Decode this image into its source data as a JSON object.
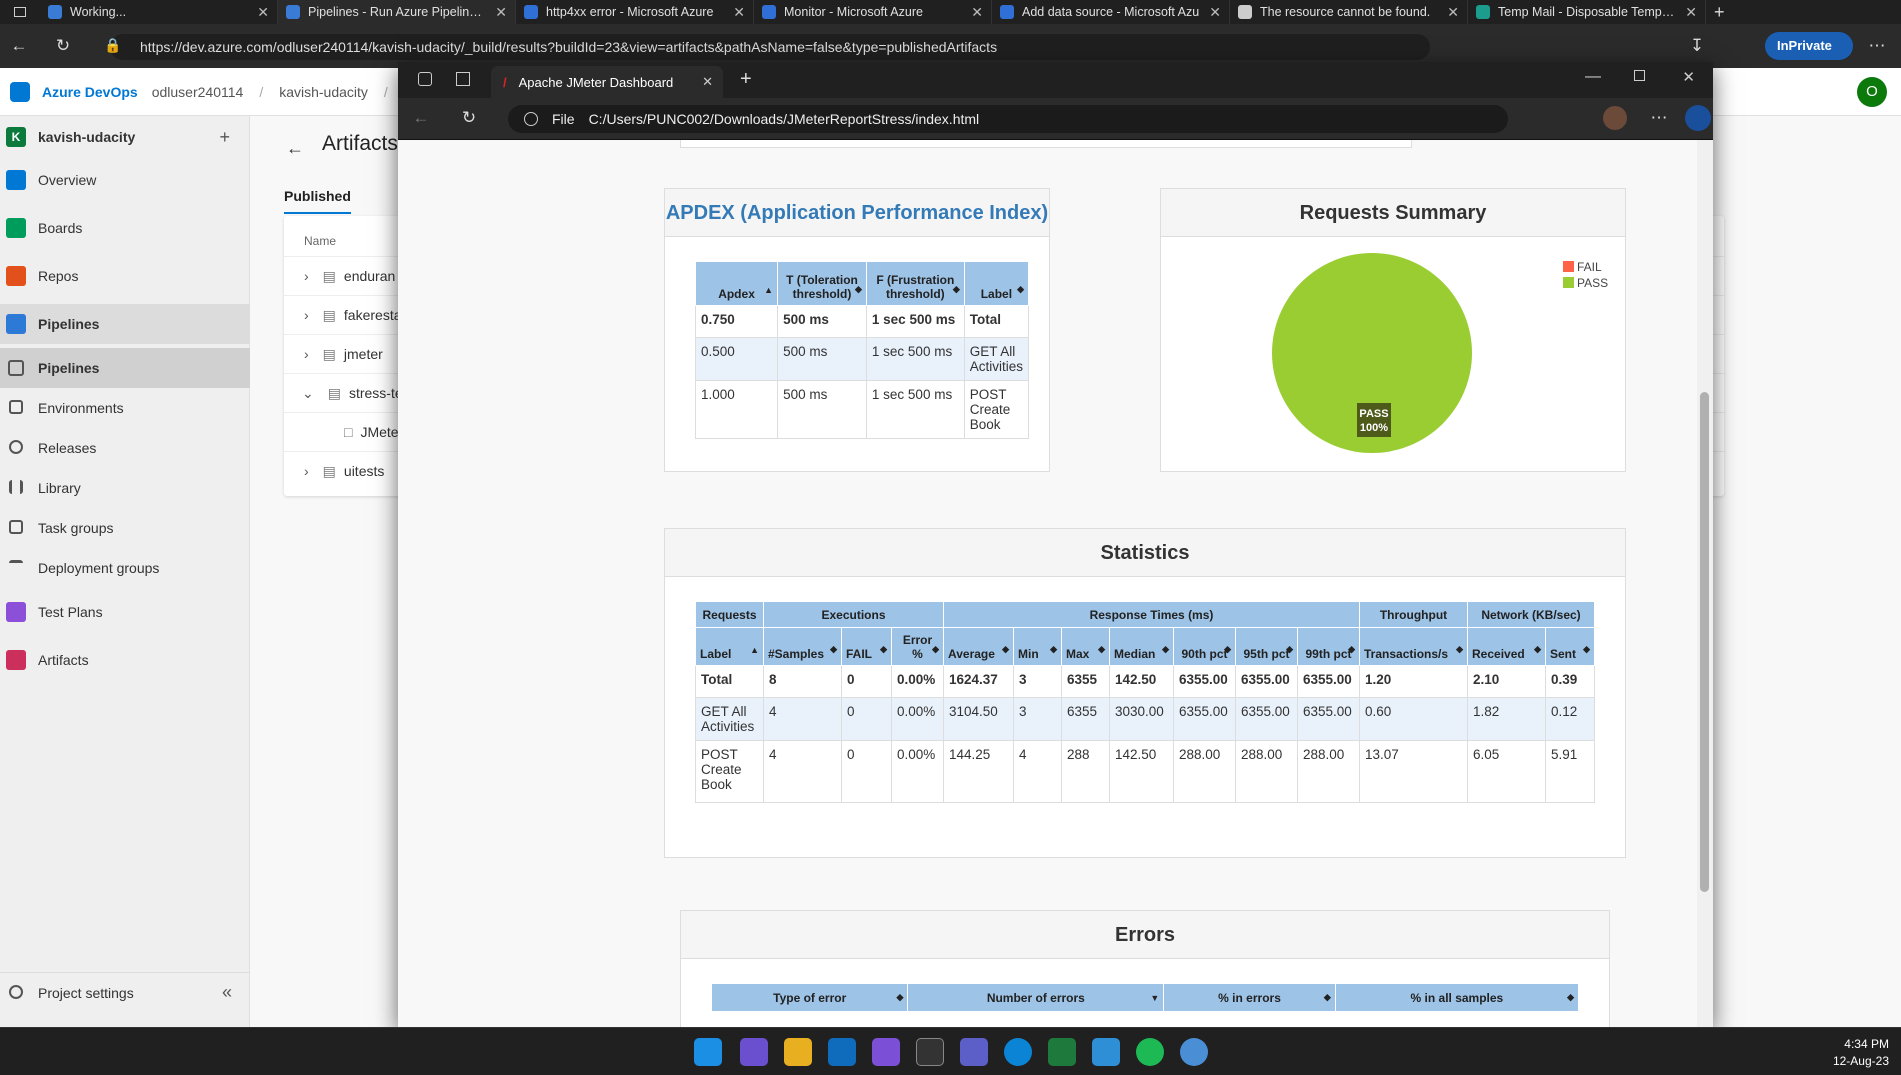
{
  "outer_tabs": [
    {
      "title": "Working..."
    },
    {
      "title": "Pipelines - Run Azure Pipelines a"
    },
    {
      "title": "http4xx error - Microsoft Azure"
    },
    {
      "title": "Monitor - Microsoft Azure"
    },
    {
      "title": "Add data source - Microsoft Azu"
    },
    {
      "title": "The resource cannot be found."
    },
    {
      "title": "Temp Mail - Disposable Tempora"
    }
  ],
  "outer_url": "https://dev.azure.com/odluser240114/kavish-udacity/_build/results?buildId=23&view=artifacts&pathAsName=false&type=publishedArtifacts",
  "inprivate_label": "InPrivate",
  "ado": {
    "brand": "Azure DevOps",
    "org": "odluser240114",
    "project_crumb": "kavish-udacity",
    "project_name": "kavish-udacity",
    "project_initial": "K",
    "nav": [
      "Overview",
      "Boards",
      "Repos",
      "Pipelines",
      "Pipelines",
      "Environments",
      "Releases",
      "Library",
      "Task groups",
      "Deployment groups",
      "Test Plans",
      "Artifacts"
    ],
    "settings": "Project settings",
    "page_title": "Artifacts",
    "tab_published": "Published",
    "col_name": "Name",
    "artifacts": [
      "enduran",
      "fakeresta",
      "jmeter",
      "stress-te",
      "JMete",
      "uitests"
    ]
  },
  "jmeter": {
    "tab_title": "Apache JMeter Dashboard",
    "url_scheme": "File",
    "url": "C:/Users/PUNC002/Downloads/JMeterReportStress/index.html",
    "apdex": {
      "title": "APDEX (Application Performance Index)",
      "headers": [
        "Apdex",
        "T (Toleration threshold)",
        "F (Frustration threshold)",
        "Label"
      ],
      "rows": [
        [
          "0.750",
          "500 ms",
          "1 sec 500 ms",
          "Total"
        ],
        [
          "0.500",
          "500 ms",
          "1 sec 500 ms",
          "GET All Activities"
        ],
        [
          "1.000",
          "500 ms",
          "1 sec 500 ms",
          "POST Create Book"
        ]
      ]
    },
    "summary": {
      "title": "Requests Summary",
      "legend": [
        "FAIL",
        "PASS"
      ],
      "slice_label": "PASS",
      "slice_pct": "100%"
    },
    "statistics": {
      "title": "Statistics",
      "groups": [
        "Requests",
        "Executions",
        "Response Times (ms)",
        "Throughput",
        "Network (KB/sec)"
      ],
      "headers": [
        "Label",
        "#Samples",
        "FAIL",
        "Error %",
        "Average",
        "Min",
        "Max",
        "Median",
        "90th pct",
        "95th pct",
        "99th pct",
        "Transactions/s",
        "Received",
        "Sent"
      ],
      "rows": [
        [
          "Total",
          "8",
          "0",
          "0.00%",
          "1624.37",
          "3",
          "6355",
          "142.50",
          "6355.00",
          "6355.00",
          "6355.00",
          "1.20",
          "2.10",
          "0.39"
        ],
        [
          "GET All Activities",
          "4",
          "0",
          "0.00%",
          "3104.50",
          "3",
          "6355",
          "3030.00",
          "6355.00",
          "6355.00",
          "6355.00",
          "0.60",
          "1.82",
          "0.12"
        ],
        [
          "POST Create Book",
          "4",
          "0",
          "0.00%",
          "144.25",
          "4",
          "288",
          "142.50",
          "288.00",
          "288.00",
          "288.00",
          "13.07",
          "6.05",
          "5.91"
        ]
      ]
    },
    "errors": {
      "title": "Errors",
      "headers": [
        "Type of error",
        "Number of errors",
        "% in errors",
        "% in all samples"
      ]
    }
  },
  "clock": {
    "time": "4:34 PM",
    "date": "12-Aug-23"
  },
  "chart_data": {
    "type": "pie",
    "title": "Requests Summary",
    "categories": [
      "FAIL",
      "PASS"
    ],
    "values": [
      0,
      100
    ],
    "colors": [
      "#ff6347",
      "#9acd32"
    ]
  }
}
